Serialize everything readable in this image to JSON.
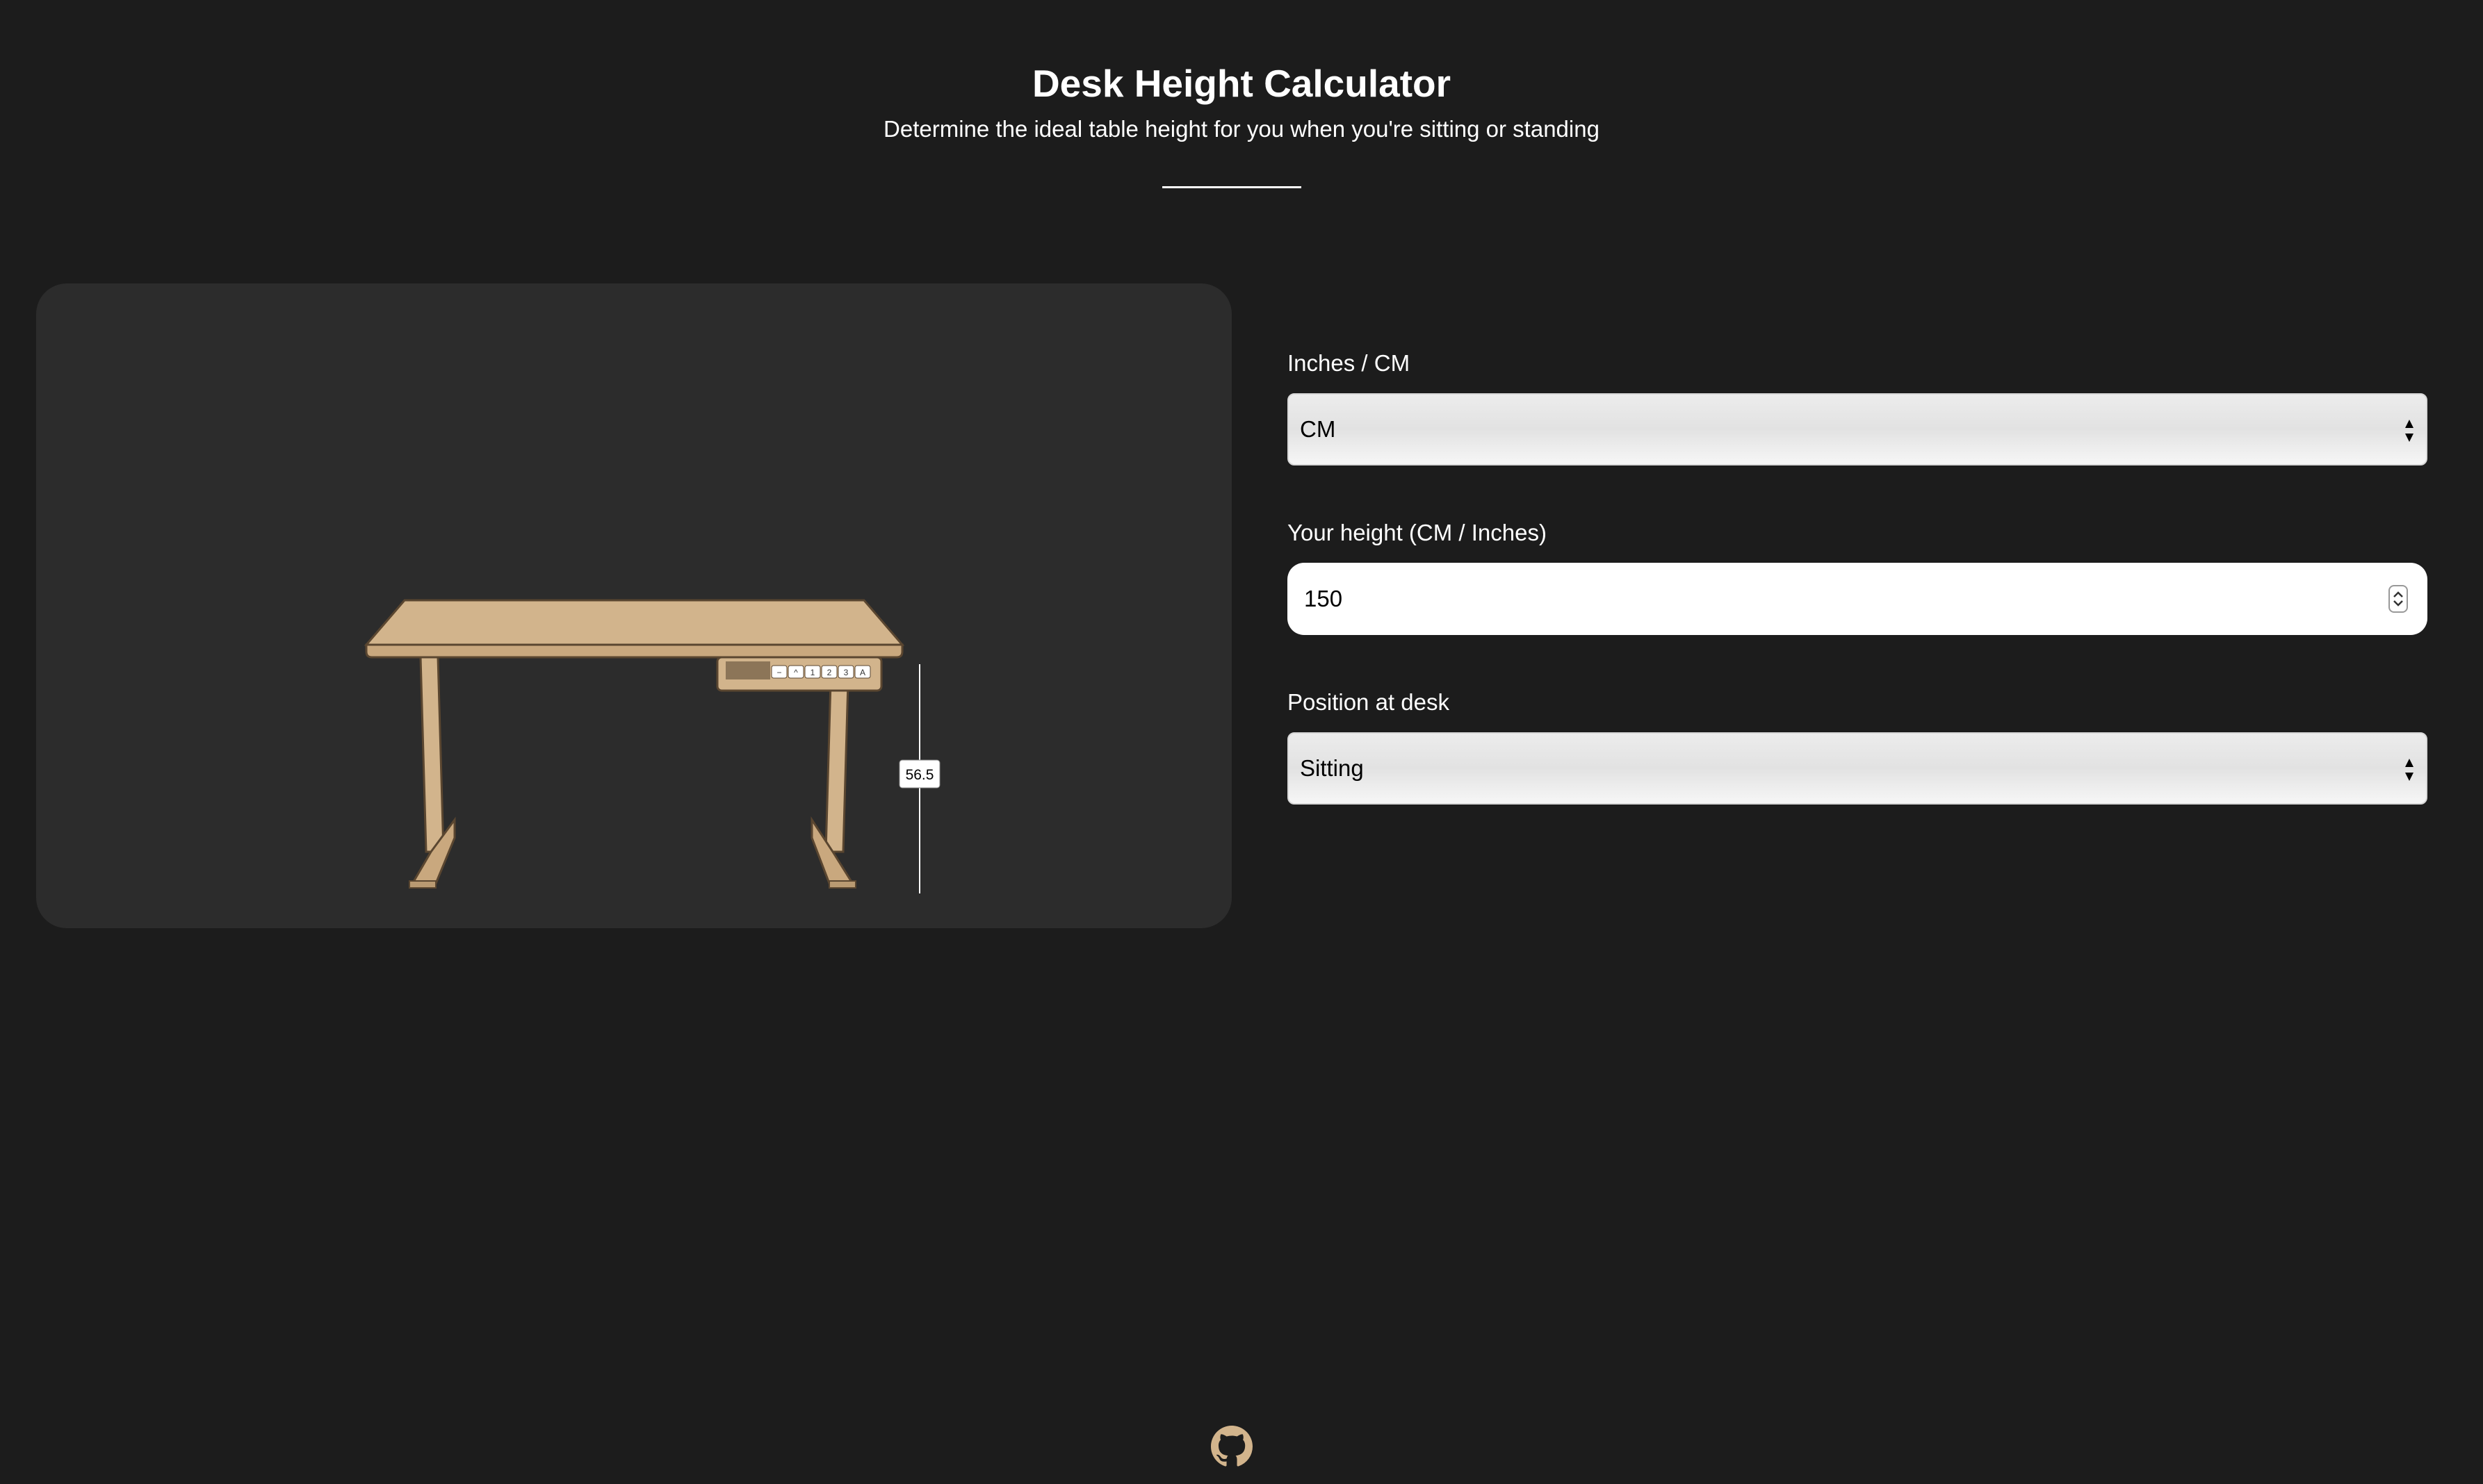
{
  "header": {
    "title": "Desk Height Calculator",
    "subtitle": "Determine the ideal table height for you when you're sitting or standing"
  },
  "visual": {
    "height_label": "56.5",
    "control_buttons": [
      "−",
      "^",
      "1",
      "2",
      "3",
      "A"
    ],
    "desk_color": "#d2b48c"
  },
  "form": {
    "unit": {
      "label": "Inches / CM",
      "value": "CM"
    },
    "height": {
      "label": "Your height (CM / Inches)",
      "value": "150"
    },
    "position": {
      "label": "Position at desk",
      "value": "Sitting"
    }
  },
  "footer": {
    "icon": "github-icon"
  },
  "colors": {
    "background": "#1c1c1c",
    "panel": "#2c2c2c",
    "accent": "#d2b48c"
  }
}
